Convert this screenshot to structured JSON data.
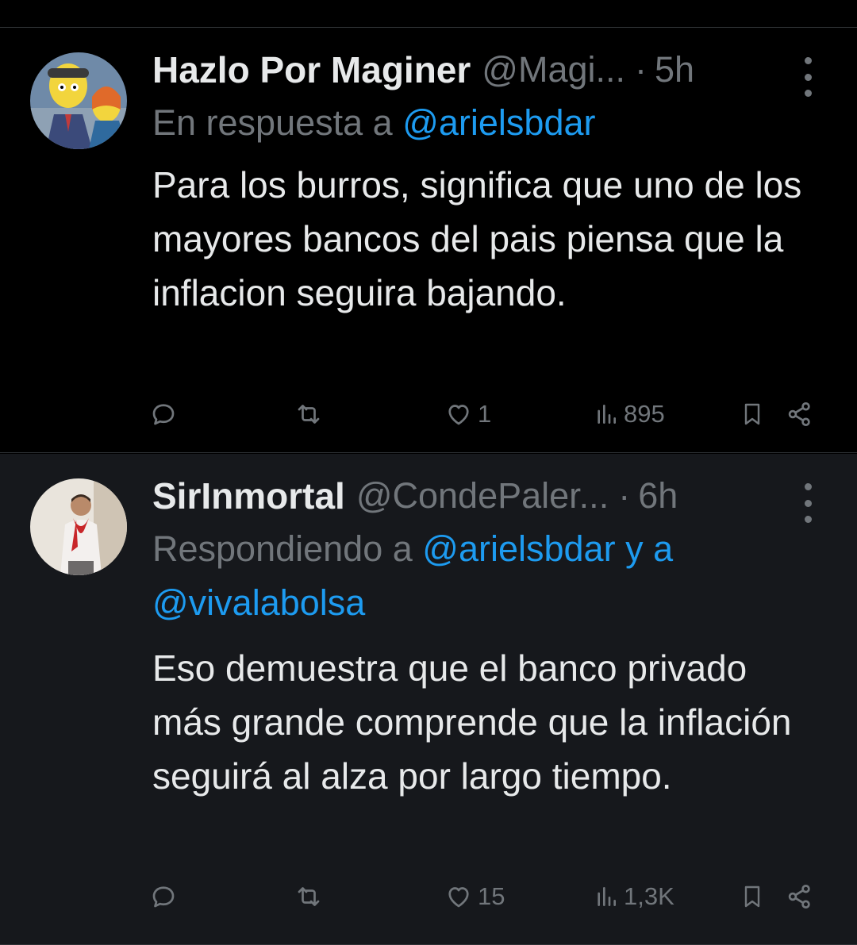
{
  "tweets": [
    {
      "name": "Hazlo Por Maginer",
      "handle": "@Magi...",
      "separator": "·",
      "time": "5h",
      "reply_prefix": "En respuesta a ",
      "reply_mentions": "@arielsbdar",
      "reply_mentions_line2": "",
      "text": "Para los burros, significa que uno de los mayores bancos del pais piensa que la inflacion seguira bajando.",
      "actions": {
        "reply_count": "",
        "retweet_count": "",
        "like_count": "1",
        "views_count": "895"
      },
      "avatar_icon": "cartoon-avatar-icon"
    },
    {
      "name": "SirInmortal",
      "handle": "@CondePaler...",
      "separator": "·",
      "time": "6h",
      "reply_prefix": "Respondiendo a ",
      "reply_mentions": "@arielsbdar y a",
      "reply_mentions_line2": "@vivalabolsa",
      "text": "Eso demuestra que el banco privado más grande comprende que la inflación seguirá al alza por largo tiempo.",
      "actions": {
        "reply_count": "",
        "retweet_count": "",
        "like_count": "15",
        "views_count": "1,3K"
      },
      "avatar_icon": "photo-avatar-icon"
    }
  ],
  "colors": {
    "background": "#000000",
    "highlight_background": "#16181c",
    "primary_text": "#e7e9ea",
    "secondary_text": "#71767b",
    "link": "#1d9bf0",
    "divider": "#2f3336"
  }
}
